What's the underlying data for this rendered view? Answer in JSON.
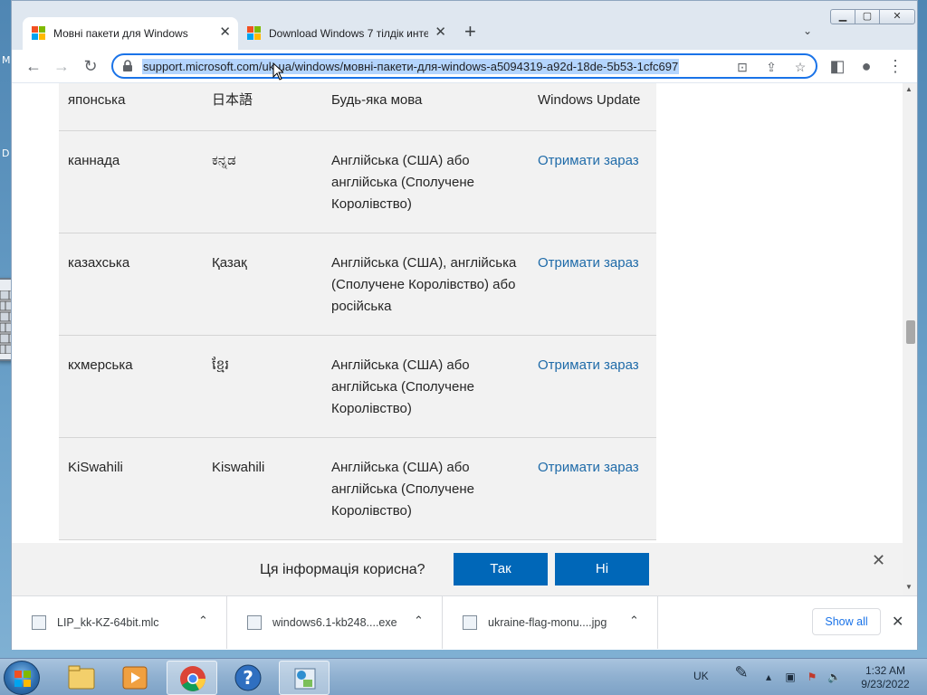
{
  "browser": {
    "tabs": [
      {
        "title": "Мовні пакети для Windows",
        "active": true
      },
      {
        "title": "Download Windows 7 тілдік инте",
        "active": false
      }
    ],
    "new_tab": "+",
    "url": "support.microsoft.com/uk-ua/windows/мовні-пакети-для-windows-a5094319-a92d-18de-5b53-1cfc697"
  },
  "table": {
    "rows": [
      {
        "lang": "японська",
        "native": "日本語",
        "required": "Будь-яка мова",
        "get": "Windows Update",
        "is_link": false
      },
      {
        "lang": "каннада",
        "native": "ಕನ್ನಡ",
        "required": "Англійська (США) або англійська (Сполучене Королівство)",
        "get": "Отримати зараз",
        "is_link": true
      },
      {
        "lang": "казахська",
        "native": "Қазақ",
        "required": "Англійська (США), англійська (Сполучене Королівство) або російська",
        "get": "Отримати зараз",
        "is_link": true
      },
      {
        "lang": "кхмерська",
        "native": "ខ្មែរ",
        "required": "Англійська (США) або англійська (Сполучене Королівство)",
        "get": "Отримати зараз",
        "is_link": true
      },
      {
        "lang": "KiSwahili",
        "native": "Kiswahili",
        "required": "Англійська (США) або англійська (Сполучене Королівство)",
        "get": "Отримати зараз",
        "is_link": true
      }
    ]
  },
  "feedback": {
    "question": "Ця інформація корисна?",
    "yes": "Так",
    "no": "Ні"
  },
  "downloads": {
    "items": [
      {
        "name": "LIP_kk-KZ-64bit.mlc",
        "icon": "setup-file-icon"
      },
      {
        "name": "windows6.1-kb248....exe",
        "icon": "exe-file-icon"
      },
      {
        "name": "ukraine-flag-monu....jpg",
        "icon": "image-file-icon"
      }
    ],
    "show_all": "Show all"
  },
  "taskbar": {
    "language": "UK",
    "time": "1:32 AM",
    "date": "9/23/2022",
    "apps": [
      "explorer-icon",
      "media-player-icon",
      "chrome-icon",
      "help-icon",
      "setup-icon"
    ]
  },
  "desktop": {
    "letters": [
      "M",
      "D"
    ]
  },
  "colors": {
    "link": "#1f6ba9",
    "button": "#0067b8",
    "url_highlight": "#b4d5fe",
    "focus_ring": "#1a73e8"
  }
}
